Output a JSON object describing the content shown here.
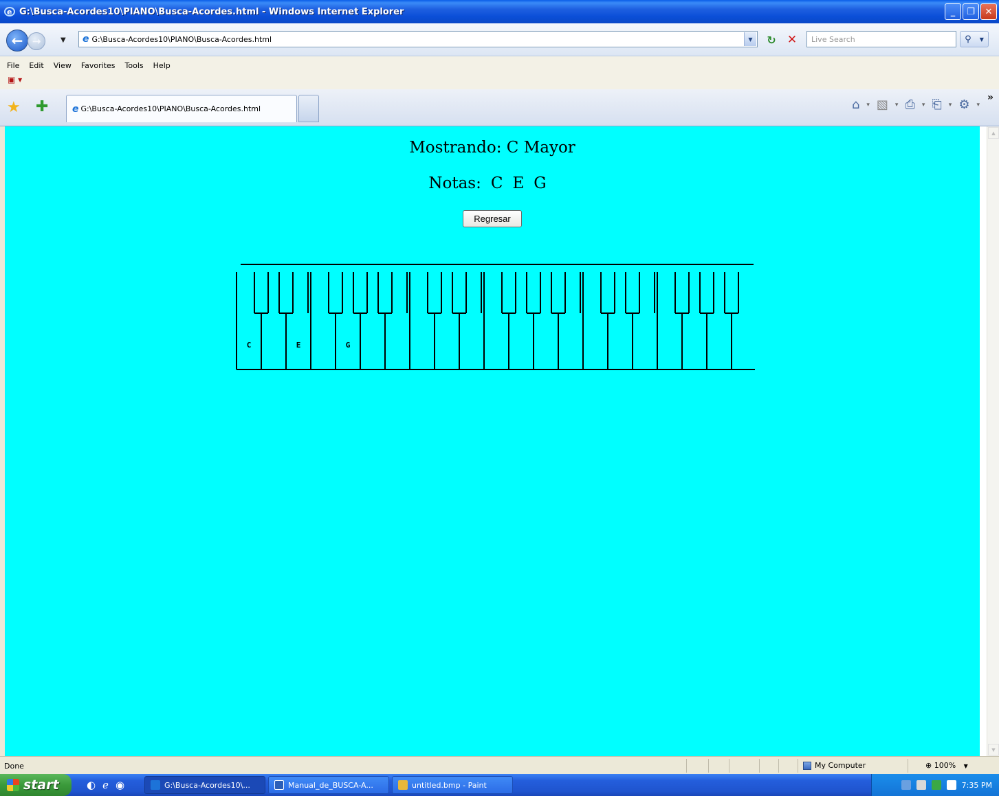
{
  "window": {
    "title": "G:\\Busca-Acordes10\\PIANO\\Busca-Acordes.html - Windows Internet Explorer",
    "buttons": [
      "_",
      "❐",
      "✕"
    ]
  },
  "address_bar": {
    "url": "G:\\Busca-Acordes10\\PIANO\\Busca-Acordes.html",
    "search_placeholder": "Live Search"
  },
  "menu": [
    "File",
    "Edit",
    "View",
    "Favorites",
    "Tools",
    "Help"
  ],
  "tab": {
    "label": "G:\\Busca-Acordes10\\PIANO\\Busca-Acordes.html"
  },
  "page": {
    "background": "#00FFFF",
    "heading": "Mostrando: C Mayor",
    "notes_label": "Notas:",
    "notes": [
      "C",
      "E",
      "G"
    ],
    "back_button": "Regresar",
    "keyboard": {
      "white_keys": 21,
      "octaves": 3,
      "highlighted_labels": [
        "C",
        "E",
        "G"
      ]
    }
  },
  "status": {
    "text": "Done",
    "zone": "My Computer",
    "zoom": "100%"
  },
  "taskbar": {
    "start": "start",
    "tasks": [
      {
        "label": "G:\\Busca-Acordes10\\...",
        "icon": "ie-icon"
      },
      {
        "label": "Manual_de_BUSCA-A...",
        "icon": "word-icon"
      },
      {
        "label": "untitled.bmp - Paint",
        "icon": "paint-icon"
      }
    ],
    "clock": "7:35 PM"
  }
}
